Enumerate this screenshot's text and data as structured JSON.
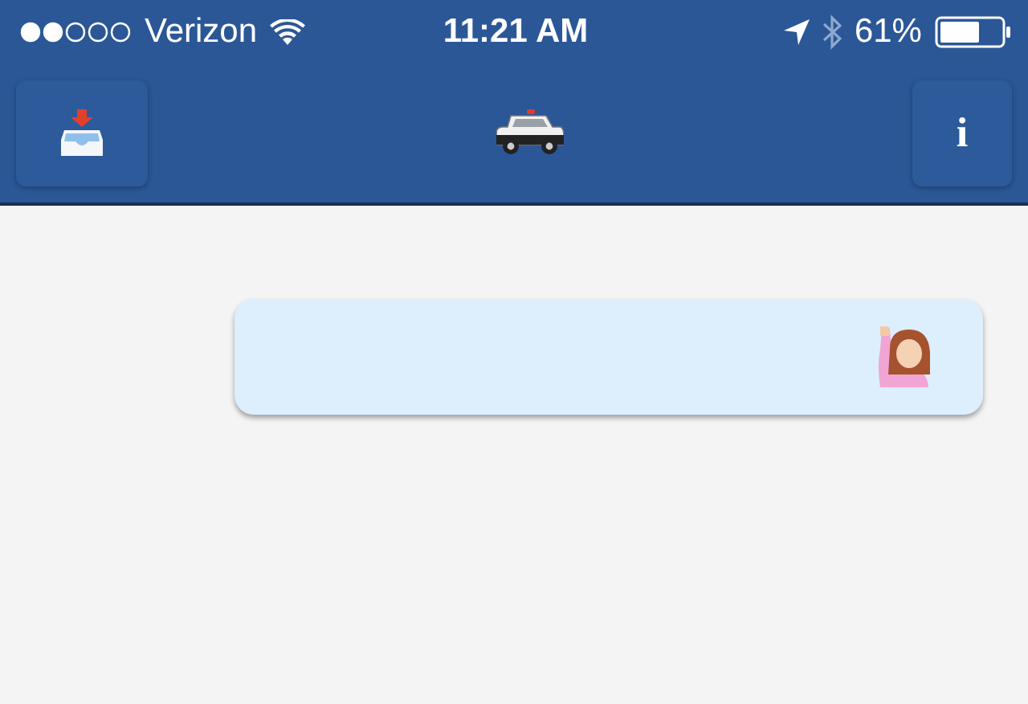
{
  "status_bar": {
    "carrier": "Verizon",
    "time": "11:21 AM",
    "battery": "61%"
  },
  "nav_bar": {
    "info_button": {
      "label": "i"
    }
  }
}
